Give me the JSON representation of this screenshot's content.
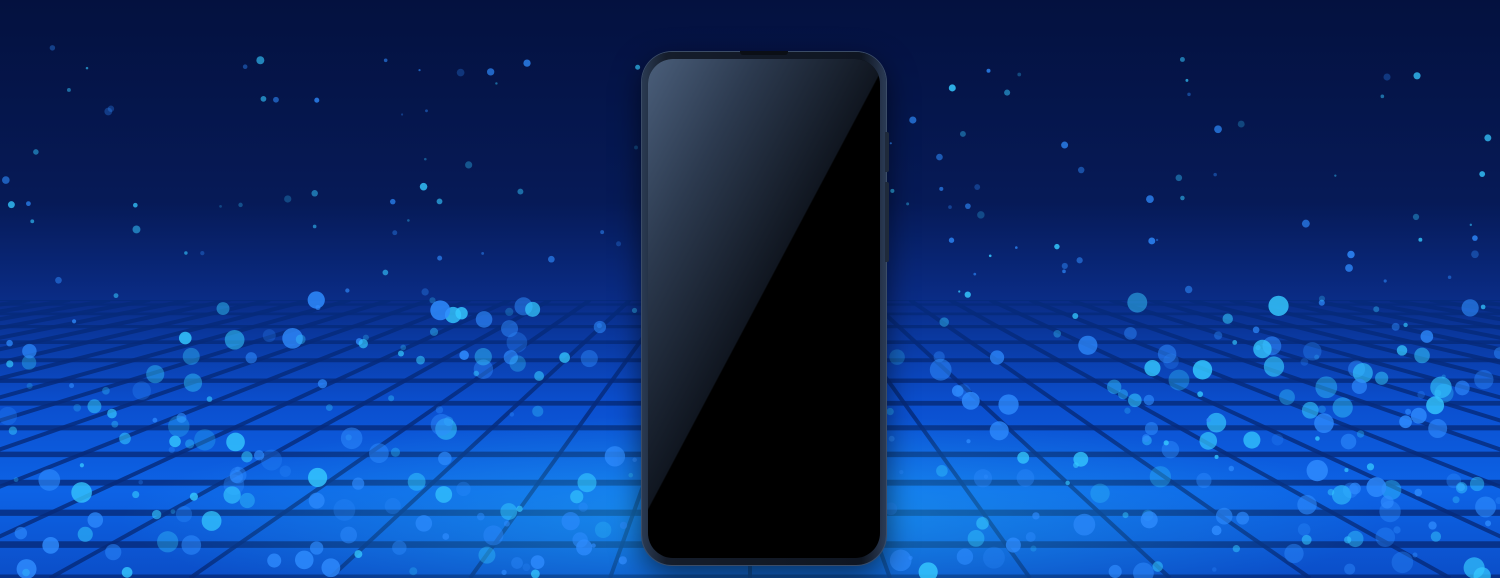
{
  "scene": {
    "subject": "smartphone-blank-screen",
    "colors": {
      "sky_top": "#04113f",
      "sky_mid": "#061a57",
      "floor_blue": "#0d63e6",
      "highlight_cyan": "#35c8ff",
      "phone_body": "#151d2b",
      "screen": "#000000"
    }
  }
}
